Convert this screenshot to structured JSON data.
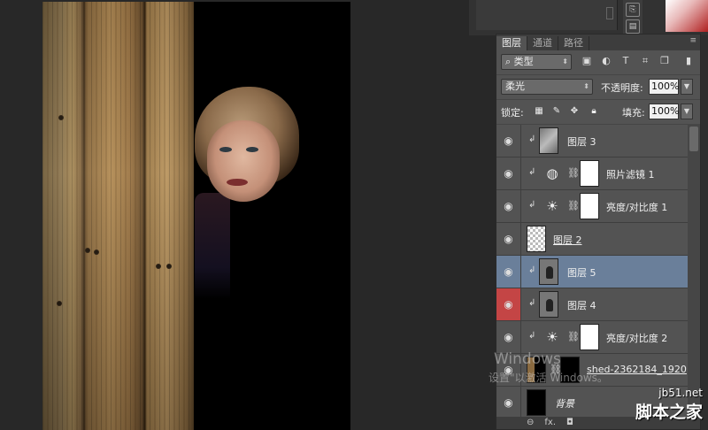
{
  "layers_panel": {
    "tabs": [
      "图层",
      "通道",
      "路径"
    ],
    "menu_icon": "≡",
    "filter_kind": "类型",
    "filter_icons": [
      "image-filter-icon",
      "adjustment-filter-icon",
      "type-filter-icon",
      "shape-filter-icon",
      "smart-object-filter-icon"
    ],
    "blend_mode": "柔光",
    "opacity_label": "不透明度:",
    "opacity_value": "100%",
    "lock_label": "锁定:",
    "fill_label": "填充:",
    "fill_value": "100%",
    "layers": [
      {
        "name": "图层 3",
        "visible": true,
        "clipped": true,
        "thumb": "gray",
        "has_mask": false,
        "selected": false
      },
      {
        "name": "照片滤镜 1",
        "visible": true,
        "clipped": true,
        "thumb": "photo-filter-adjustment",
        "has_mask": true,
        "selected": false
      },
      {
        "name": "亮度/对比度 1",
        "visible": true,
        "clipped": true,
        "thumb": "brightness-contrast-adjustment",
        "has_mask": true,
        "selected": false
      },
      {
        "name": "图层 2",
        "visible": true,
        "clipped": false,
        "thumb": "transparent",
        "has_mask": false,
        "selected": false
      },
      {
        "name": "图层 5",
        "visible": true,
        "clipped": true,
        "thumb": "figure",
        "has_mask": false,
        "selected": true
      },
      {
        "name": "图层 4",
        "visible": true,
        "clipped": true,
        "thumb": "figure",
        "has_mask": false,
        "selected": false,
        "eye_highlight": "#c44545"
      },
      {
        "name": "亮度/对比度 2",
        "visible": true,
        "clipped": true,
        "thumb": "brightness-contrast-adjustment",
        "has_mask": true,
        "selected": false
      },
      {
        "name": "shed-2362184_1920",
        "visible": true,
        "clipped": false,
        "thumb": "photo",
        "has_mask": true,
        "selected": false
      },
      {
        "name": "背景",
        "visible": true,
        "clipped": false,
        "thumb": "black",
        "has_mask": false,
        "selected": false
      }
    ],
    "footer_icons": [
      "link-icon",
      "fx-icon",
      "mask-icon"
    ],
    "footer_labels": [
      "⊖",
      "fx.",
      "◘"
    ]
  },
  "overlay": {
    "windows_title": "Windows",
    "windows_sub": "设置\"以激活 Windows。",
    "watermark_site": "jb51.net",
    "watermark_name": "脚本之家"
  }
}
